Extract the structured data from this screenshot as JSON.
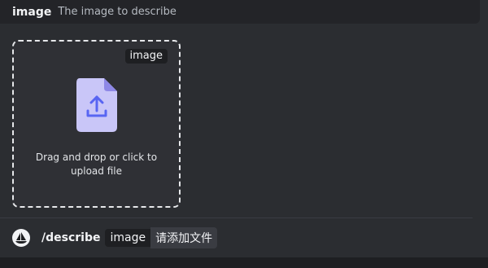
{
  "option": {
    "name": "image",
    "description": "The image to describe"
  },
  "upload": {
    "tag": "image",
    "instruction_line1": "Drag and drop or click to",
    "instruction_line2": "upload file",
    "icon": "file-upload-icon"
  },
  "command": {
    "name": "/describe",
    "option_name": "image",
    "option_value": "请添加文件",
    "avatar_icon": "midjourney-boat-icon"
  },
  "colors": {
    "background": "#2b2d31",
    "header": "#232428",
    "file_icon": "#c9c6f8",
    "file_icon_accent": "#5865f2"
  }
}
